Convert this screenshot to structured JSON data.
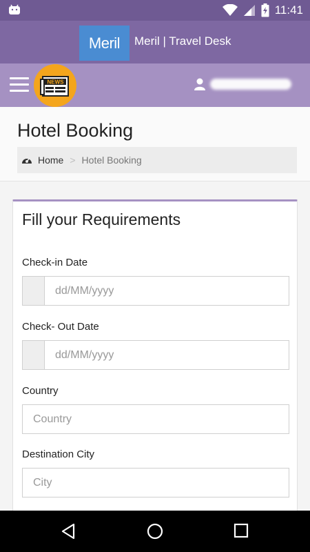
{
  "status_bar": {
    "time": "11:41",
    "icons": [
      "android-icon",
      "wifi-icon",
      "signal-icon",
      "battery-charging-icon"
    ]
  },
  "brand": {
    "logo_text": "Meril",
    "title": "Meril | Travel Desk"
  },
  "navbar": {
    "menu_icon": "hamburger-icon",
    "news_badge_text": "NEWS",
    "user_icon": "user-icon"
  },
  "page": {
    "title": "Hotel Booking",
    "breadcrumb": {
      "home": "Home",
      "separator": ">",
      "current": "Hotel Booking"
    }
  },
  "form": {
    "title": "Fill your Requirements",
    "checkin": {
      "label": "Check-in Date",
      "placeholder": "dd/MM/yyyy"
    },
    "checkout": {
      "label": "Check- Out Date",
      "placeholder": "dd/MM/yyyy"
    },
    "country": {
      "label": "Country",
      "placeholder": "Country"
    },
    "city": {
      "label": "Destination City",
      "placeholder": "City"
    }
  },
  "colors": {
    "statusbar": "#6f5a93",
    "brandbar": "#7e68a2",
    "navbar": "#a591c2",
    "logo": "#4a8cd2",
    "news_badge": "#f4a51c"
  }
}
